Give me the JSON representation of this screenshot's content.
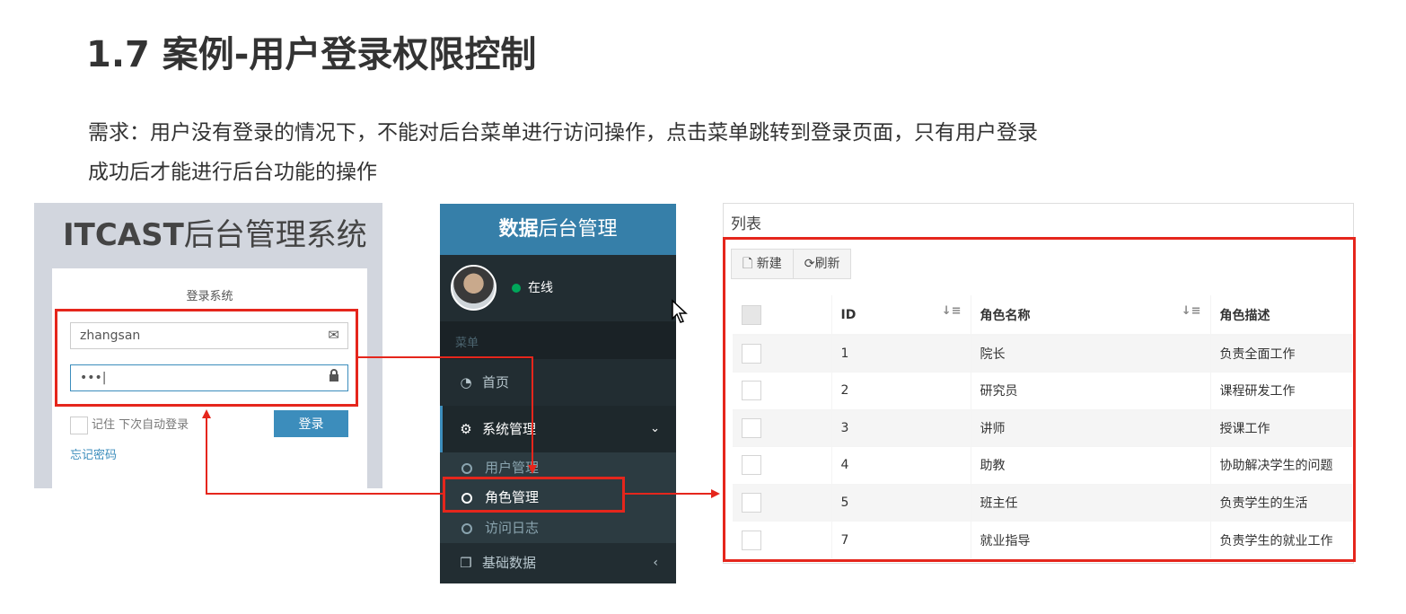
{
  "title": "1.7 案例-用户登录权限控制",
  "requirement": {
    "line1": "需求：用户没有登录的情况下，不能对后台菜单进行访问操作，点击菜单跳转到登录页面，只有用户登录",
    "line2": "成功后才能进行后台功能的操作"
  },
  "login": {
    "brand_bold": "ITCAST",
    "brand_rest": "后台管理系统",
    "message": "登录系统",
    "username_value": "zhangsan",
    "password_value": "•••|",
    "remember_label": "记住 下次自动登录",
    "login_button": "登录",
    "forgot_link": "忘记密码"
  },
  "sidebar": {
    "header_bold": "数据",
    "header_rest": "后台管理",
    "status": "在线",
    "menu_header": "菜单",
    "home": "首页",
    "system": "系统管理",
    "sub_items": [
      "用户管理",
      "角色管理",
      "访问日志"
    ],
    "base_data": "基础数据"
  },
  "list": {
    "title": "列表",
    "btn_new": "新建",
    "btn_refresh": "刷新",
    "columns": [
      "ID",
      "角色名称",
      "角色描述"
    ],
    "rows": [
      {
        "id": "1",
        "name": "院长",
        "desc": "负责全面工作"
      },
      {
        "id": "2",
        "name": "研究员",
        "desc": "课程研发工作"
      },
      {
        "id": "3",
        "name": "讲师",
        "desc": "授课工作"
      },
      {
        "id": "4",
        "name": "助教",
        "desc": "协助解决学生的问题"
      },
      {
        "id": "5",
        "name": "班主任",
        "desc": "负责学生的生活"
      },
      {
        "id": "7",
        "name": "就业指导",
        "desc": "负责学生的就业工作"
      }
    ]
  },
  "colors": {
    "highlight_red": "#e5261c",
    "primary_blue": "#3c8dbc",
    "sidebar_dark": "#222d32",
    "online_green": "#00a65a"
  }
}
